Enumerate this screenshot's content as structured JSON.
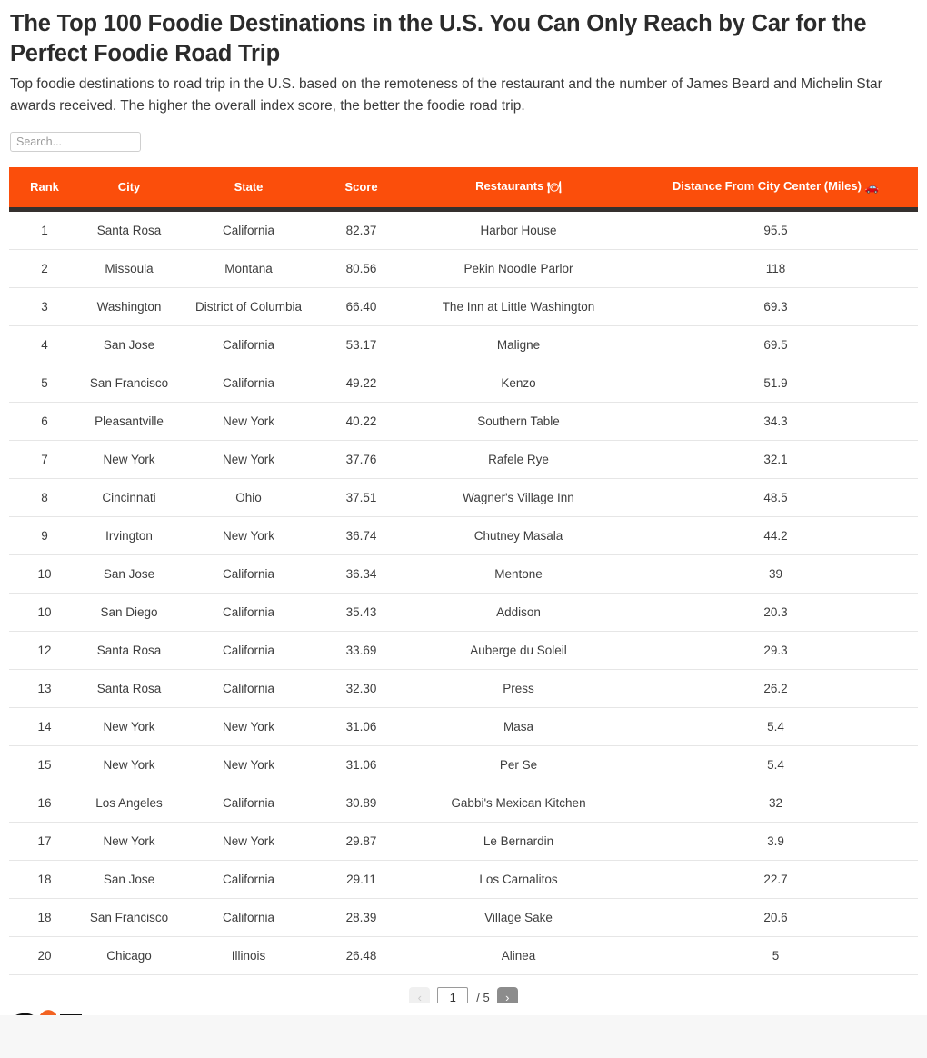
{
  "header": {
    "title": "The Top 100 Foodie Destinations in the U.S. You Can Only Reach by Car for the Perfect Foodie Road Trip",
    "subtitle": "Top foodie destinations to road trip in the U.S. based on the remoteness of the restaurant and the number of James Beard and Michelin Star awards received. The higher the overall index score, the better the foodie road trip."
  },
  "search": {
    "placeholder": "Search...",
    "value": ""
  },
  "colors": {
    "header_orange": "#fb4e0b",
    "header_border": "#35302e",
    "row_divider": "#e6e6e6",
    "next_button": "#8c8c8c",
    "prev_button": "#f0f0f0",
    "page_band": "#f7f7f7",
    "logo_orange": "#f26322"
  },
  "table": {
    "columns": [
      {
        "label": "Rank",
        "icon": ""
      },
      {
        "label": "City",
        "icon": ""
      },
      {
        "label": "State",
        "icon": ""
      },
      {
        "label": "Score",
        "icon": ""
      },
      {
        "label": "Restaurants",
        "icon": "🍽"
      },
      {
        "label": "Distance From City Center (Miles)",
        "icon": "🚗"
      }
    ],
    "rows": [
      {
        "rank": "1",
        "city": "Santa Rosa",
        "state": "California",
        "score": "82.37",
        "restaurant": "Harbor House",
        "distance": "95.5"
      },
      {
        "rank": "2",
        "city": "Missoula",
        "state": "Montana",
        "score": "80.56",
        "restaurant": "Pekin Noodle Parlor",
        "distance": "118"
      },
      {
        "rank": "3",
        "city": "Washington",
        "state": "District of Columbia",
        "score": "66.40",
        "restaurant": "The Inn at Little Washington",
        "distance": "69.3"
      },
      {
        "rank": "4",
        "city": "San Jose",
        "state": "California",
        "score": "53.17",
        "restaurant": "Maligne",
        "distance": "69.5"
      },
      {
        "rank": "5",
        "city": "San Francisco",
        "state": "California",
        "score": "49.22",
        "restaurant": "Kenzo",
        "distance": "51.9"
      },
      {
        "rank": "6",
        "city": "Pleasantville",
        "state": "New York",
        "score": "40.22",
        "restaurant": "Southern Table",
        "distance": "34.3"
      },
      {
        "rank": "7",
        "city": "New York",
        "state": "New York",
        "score": "37.76",
        "restaurant": "Rafele Rye",
        "distance": "32.1"
      },
      {
        "rank": "8",
        "city": "Cincinnati",
        "state": "Ohio",
        "score": "37.51",
        "restaurant": "Wagner's Village Inn",
        "distance": "48.5"
      },
      {
        "rank": "9",
        "city": "Irvington",
        "state": "New York",
        "score": "36.74",
        "restaurant": "Chutney Masala",
        "distance": "44.2"
      },
      {
        "rank": "10",
        "city": "San Jose",
        "state": "California",
        "score": "36.34",
        "restaurant": "Mentone",
        "distance": "39"
      },
      {
        "rank": "10",
        "city": "San Diego",
        "state": "California",
        "score": "35.43",
        "restaurant": "Addison",
        "distance": "20.3"
      },
      {
        "rank": "12",
        "city": "Santa Rosa",
        "state": "California",
        "score": "33.69",
        "restaurant": "Auberge du Soleil",
        "distance": "29.3"
      },
      {
        "rank": "13",
        "city": "Santa Rosa",
        "state": "California",
        "score": "32.30",
        "restaurant": "Press",
        "distance": "26.2"
      },
      {
        "rank": "14",
        "city": "New York",
        "state": "New York",
        "score": "31.06",
        "restaurant": "Masa",
        "distance": "5.4"
      },
      {
        "rank": "15",
        "city": "New York",
        "state": "New York",
        "score": "31.06",
        "restaurant": "Per Se",
        "distance": "5.4"
      },
      {
        "rank": "16",
        "city": "Los Angeles",
        "state": "California",
        "score": "30.89",
        "restaurant": "Gabbi's Mexican Kitchen",
        "distance": "32"
      },
      {
        "rank": "17",
        "city": "New York",
        "state": "New York",
        "score": "29.87",
        "restaurant": "Le Bernardin",
        "distance": "3.9"
      },
      {
        "rank": "18",
        "city": "San Jose",
        "state": "California",
        "score": "29.11",
        "restaurant": "Los Carnalitos",
        "distance": "22.7"
      },
      {
        "rank": "18",
        "city": "San Francisco",
        "state": "California",
        "score": "28.39",
        "restaurant": "Village Sake",
        "distance": "20.6"
      },
      {
        "rank": "20",
        "city": "Chicago",
        "state": "Illinois",
        "score": "26.48",
        "restaurant": "Alinea",
        "distance": "5"
      }
    ]
  },
  "pagination": {
    "prev_label": "‹",
    "next_label": "›",
    "current_page": "1",
    "total_label": "/ 5"
  }
}
